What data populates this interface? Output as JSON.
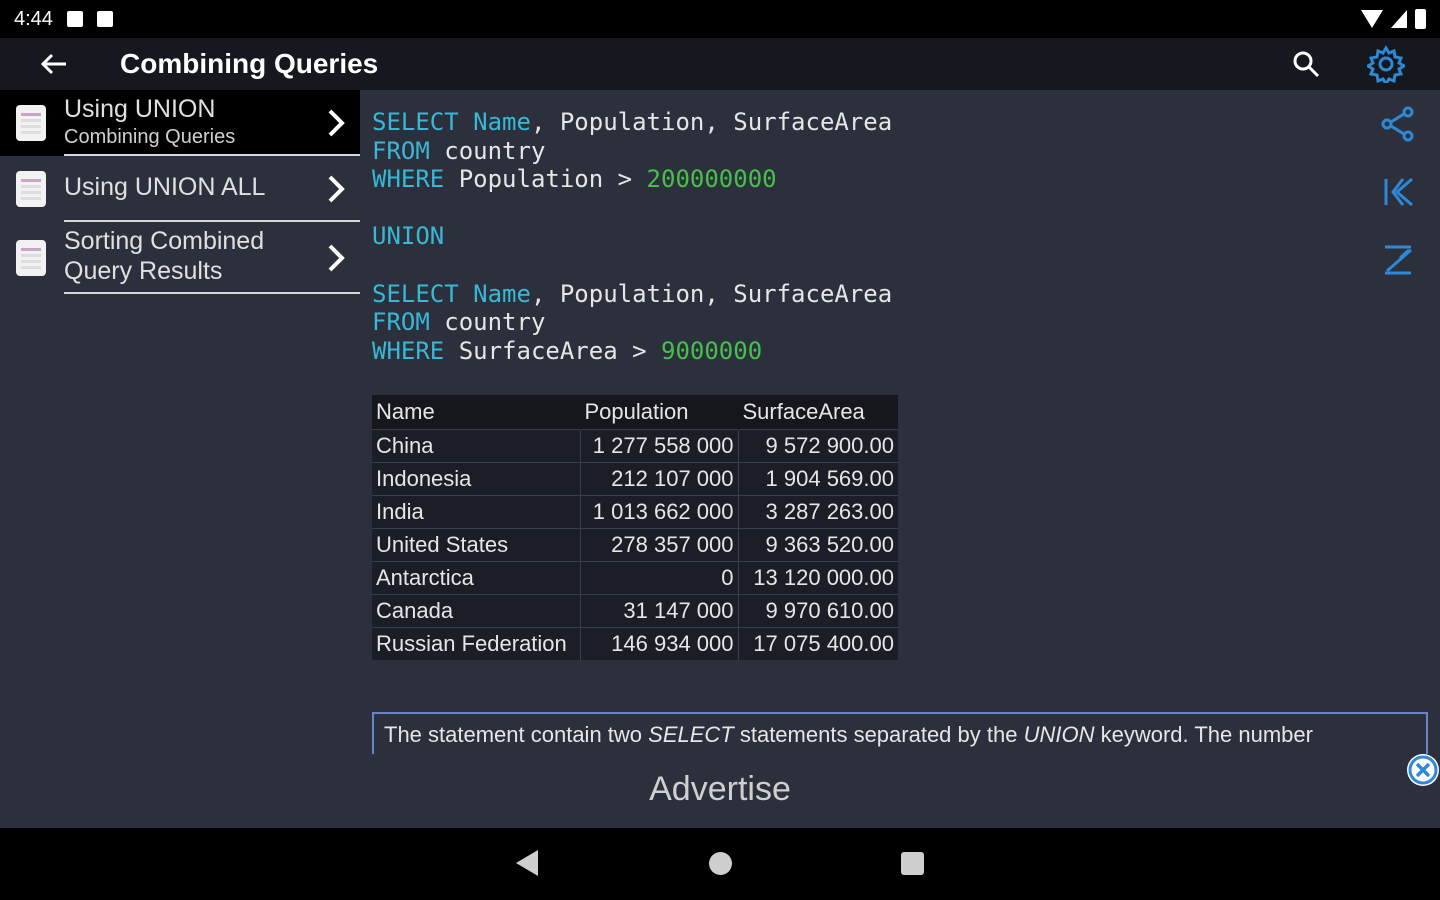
{
  "status_bar": {
    "time": "4:44"
  },
  "app_bar": {
    "title": "Combining Queries",
    "back_icon": "arrow-left-icon",
    "search_icon": "search-icon",
    "settings_icon": "gear-icon"
  },
  "sidebar": {
    "items": [
      {
        "label": "Using UNION",
        "sublabel": "Combining Queries",
        "active": true
      },
      {
        "label": "Using UNION ALL",
        "sublabel": "",
        "active": false
      },
      {
        "label": "Sorting Combined",
        "label2": "Query Results",
        "active": false
      }
    ]
  },
  "code": {
    "q1_select": "SELECT",
    "q1_name": "Name",
    "q1_cols": ", Population, SurfaceArea",
    "q1_from": "FROM",
    "q1_table": " country",
    "q1_where": "WHERE",
    "q1_cond": " Population > ",
    "q1_value": "200000000",
    "union": "UNION",
    "q2_select": "SELECT",
    "q2_name": "Name",
    "q2_cols": ", Population, SurfaceArea",
    "q2_from": "FROM",
    "q2_table": " country",
    "q2_where": "WHERE",
    "q2_cond": " SurfaceArea > ",
    "q2_value": "9000000"
  },
  "result_table": {
    "headers": [
      "Name",
      "Population",
      "SurfaceArea"
    ],
    "rows": [
      [
        "China",
        "1 277 558 000",
        "9 572 900.00"
      ],
      [
        "Indonesia",
        "212 107 000",
        "1 904 569.00"
      ],
      [
        "India",
        "1 013 662 000",
        "3 287 263.00"
      ],
      [
        "United States",
        "278 357 000",
        "9 363 520.00"
      ],
      [
        "Antarctica",
        "0",
        "13 120 000.00"
      ],
      [
        "Canada",
        "31 147 000",
        "9 970 610.00"
      ],
      [
        "Russian Federation",
        "146 934 000",
        "17 075 400.00"
      ]
    ]
  },
  "right_toolbar": {
    "share_icon": "share-icon",
    "first_icon": "skip-first-icon",
    "last_icon": "skip-last-icon"
  },
  "description": {
    "part1": "The statement contain two ",
    "em1": "SELECT",
    "part2": " statements separated by the ",
    "em2": "UNION",
    "part3": " keyword. The number"
  },
  "ad": {
    "label": "Advertise",
    "close_icon": "close-circle-icon"
  },
  "nav_bar": {
    "back_icon": "triangle-back-icon",
    "home_icon": "circle-home-icon",
    "recent_icon": "square-recents-icon"
  },
  "colors": {
    "keyword": "#39b8d6",
    "number": "#46c04a",
    "accent": "#2f88d6"
  }
}
